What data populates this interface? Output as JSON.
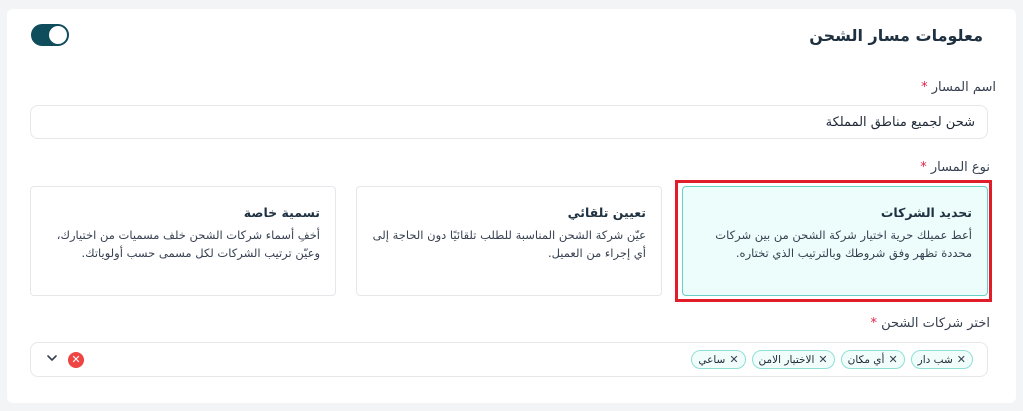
{
  "section": {
    "title": "معلومات مسار الشحن",
    "enabled": true
  },
  "route_name": {
    "label": "اسم المسار",
    "required_mark": "*",
    "value": "شحن لجميع مناطق المملكة"
  },
  "route_type": {
    "label": "نوع المسار",
    "required_mark": "*",
    "options": [
      {
        "title": "تحديد الشركات",
        "description": "أعط عميلك حرية اختيار شركة الشحن من بين شركات محددة تظهر وفق شروطك وبالترتيب الذي تختاره.",
        "selected": true
      },
      {
        "title": "تعيين تلقائي",
        "description": "عيّن شركة الشحن المناسبة للطلب تلقائيًا دون الحاجة إلى أي إجراء من العميل.",
        "selected": false
      },
      {
        "title": "تسمية خاصة",
        "description": "أخفِ أسماء شركات الشحن خلف مسميات من اختيارك، وعيّن ترتيب الشركات لكل مسمى حسب أولوياتك.",
        "selected": false
      }
    ]
  },
  "carriers": {
    "label": "اختر شركات الشحن",
    "required_mark": "*",
    "chips": [
      {
        "label": "شب دار",
        "remove": "✕"
      },
      {
        "label": "أي مكان",
        "remove": "✕"
      },
      {
        "label": "الاختيار الامن",
        "remove": "✕"
      },
      {
        "label": "ساعي",
        "remove": "✕"
      }
    ],
    "clear_icon": "close-circle-icon",
    "clear_glyph": "✕",
    "dropdown_icon": "chevron-down-icon"
  },
  "colors": {
    "accent": "#0f4c5c",
    "selected_bg": "#ecfdfc",
    "selected_border": "#67d0c6",
    "required": "#e11d48",
    "annotation": "#e11d2a"
  }
}
